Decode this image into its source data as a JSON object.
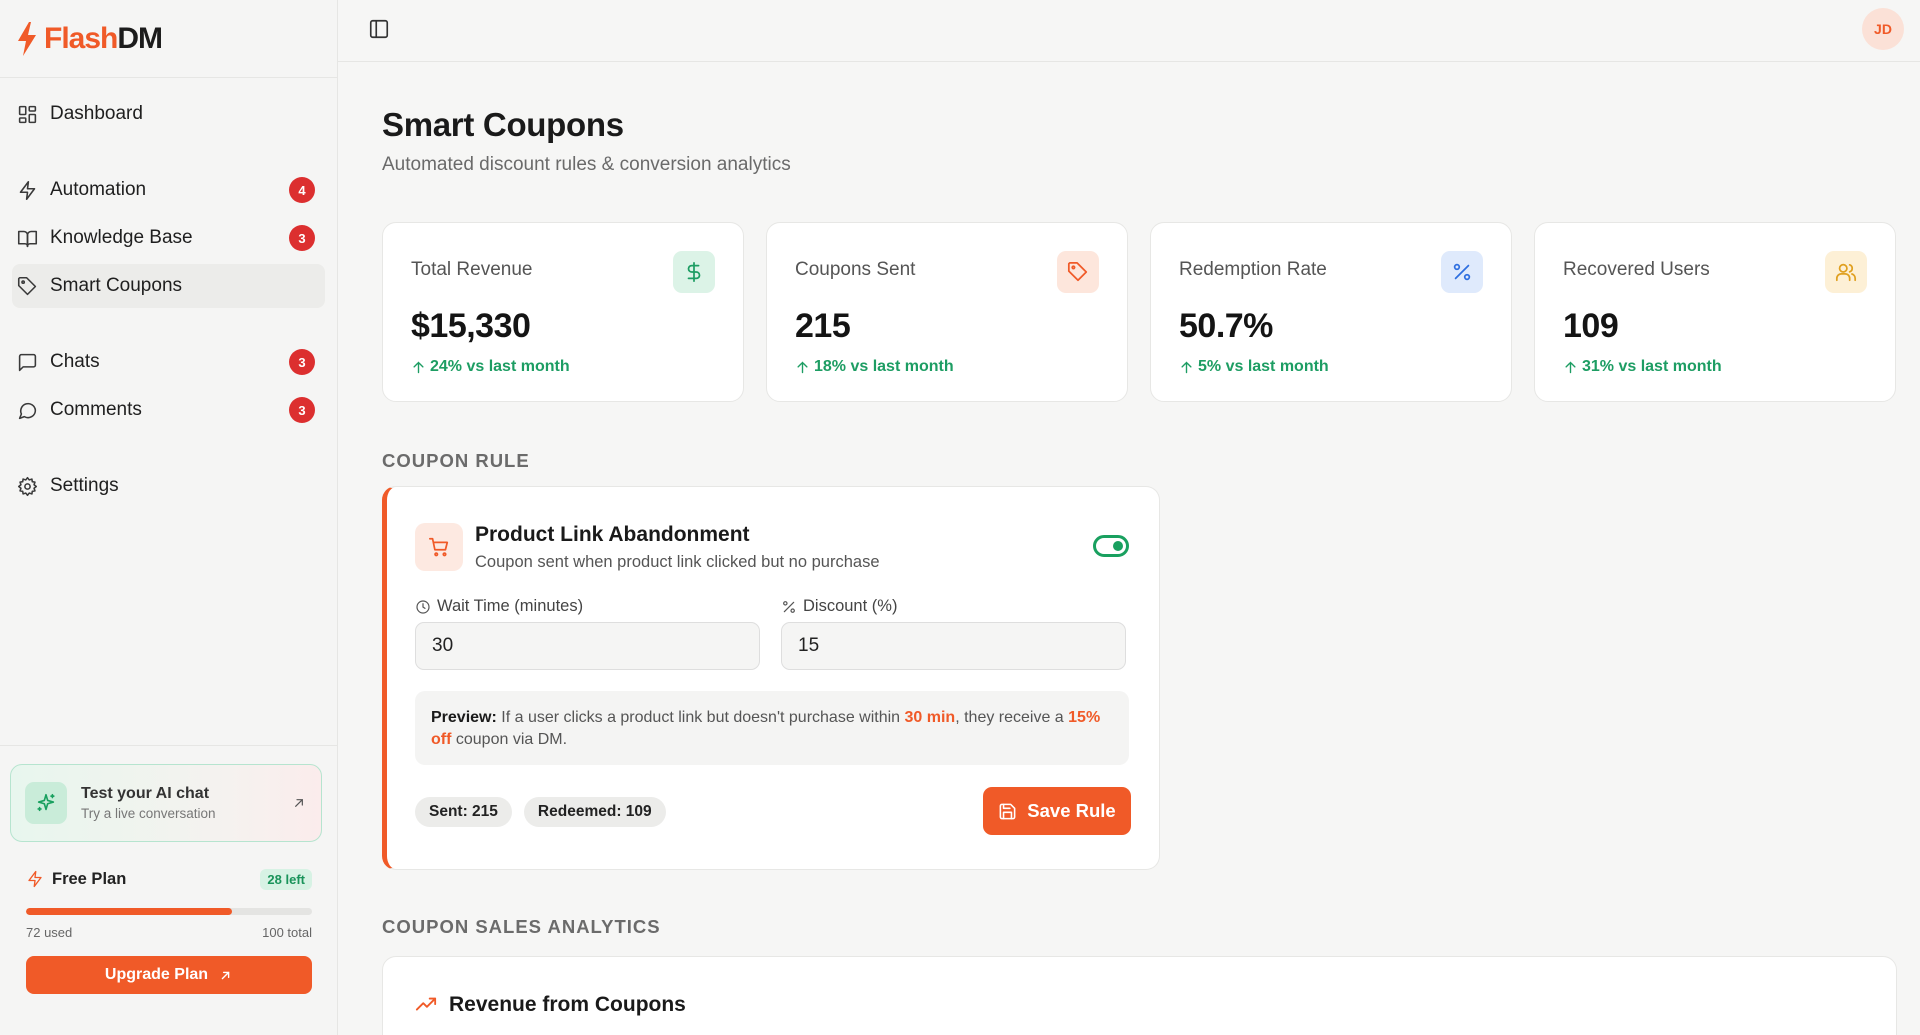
{
  "brand": {
    "flash": "Flash",
    "dm": "DM",
    "accent": "#f05a28"
  },
  "sidebar": {
    "items": [
      {
        "label": "Dashboard",
        "icon": "dashboard-icon",
        "badge": ""
      },
      {
        "label": "Automation",
        "icon": "bolt-icon",
        "badge": "4"
      },
      {
        "label": "Knowledge Base",
        "icon": "book-icon",
        "badge": "3"
      },
      {
        "label": "Smart Coupons",
        "icon": "tag-icon",
        "badge": "",
        "active": true
      },
      {
        "label": "Chats",
        "icon": "chat-icon",
        "badge": "3"
      },
      {
        "label": "Comments",
        "icon": "comment-icon",
        "badge": "3"
      },
      {
        "label": "Settings",
        "icon": "gear-icon",
        "badge": ""
      }
    ],
    "test_card": {
      "title": "Test your AI chat",
      "subtitle": "Try a live conversation"
    },
    "plan": {
      "title": "Free Plan",
      "left_badge": "28 left",
      "used_label": "72 used",
      "total_label": "100 total",
      "used_fraction": 0.72,
      "upgrade_label": "Upgrade Plan"
    }
  },
  "topbar": {
    "avatar_initials": "JD"
  },
  "page": {
    "title": "Smart Coupons",
    "subtitle": "Automated discount rules & conversion analytics"
  },
  "stats": [
    {
      "label": "Total Revenue",
      "value": "$15,330",
      "trend": "24% vs last month",
      "icon": "dollar-icon",
      "icon_color": "#1d9d63",
      "icon_bg": "#dcf3e7"
    },
    {
      "label": "Coupons Sent",
      "value": "215",
      "trend": "18% vs last month",
      "icon": "tag-icon",
      "icon_color": "#f05a28",
      "icon_bg": "#fde6dc"
    },
    {
      "label": "Redemption Rate",
      "value": "50.7%",
      "trend": "5% vs last month",
      "icon": "percent-icon",
      "icon_color": "#2f6fe0",
      "icon_bg": "#dfeafc"
    },
    {
      "label": "Recovered Users",
      "value": "109",
      "trend": "31% vs last month",
      "icon": "users-icon",
      "icon_color": "#e0a020",
      "icon_bg": "#fdf0d6"
    }
  ],
  "rule_section": {
    "title": "COUPON RULE"
  },
  "rule": {
    "name": "Product Link Abandonment",
    "description": "Coupon sent when product link clicked but no purchase",
    "enabled": true,
    "wait_label": "Wait Time (minutes)",
    "wait_value": "30",
    "discount_label": "Discount (%)",
    "discount_value": "15",
    "preview": {
      "lead": "Preview:",
      "text1": " If a user clicks a product link but doesn't purchase within ",
      "hl1": "30 min",
      "text2": ", they receive a ",
      "hl2": "15% off",
      "text3": " coupon via DM."
    },
    "sent_chip": "Sent: 215",
    "redeemed_chip": "Redeemed: 109",
    "save_label": "Save Rule"
  },
  "analytics_section": {
    "title": "COUPON SALES ANALYTICS",
    "card_title": "Revenue from Coupons"
  }
}
